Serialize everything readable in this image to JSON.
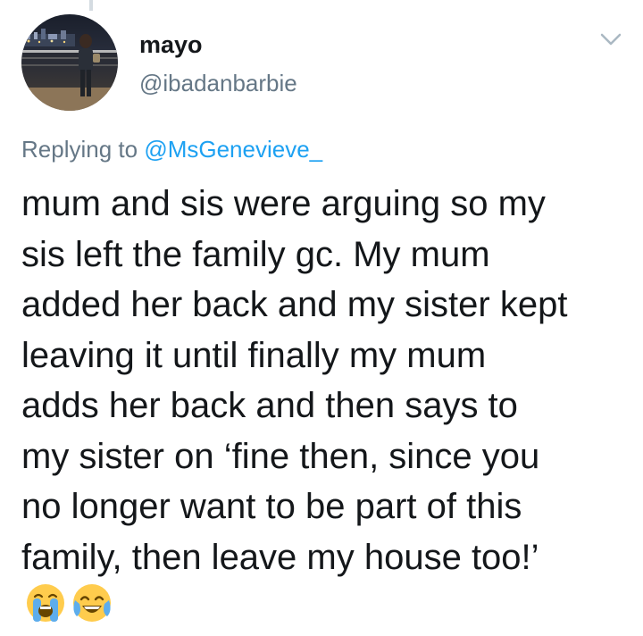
{
  "tweet": {
    "author": {
      "display_name": "mayo",
      "handle": "@ibadanbarbie",
      "avatar_icon": "profile-photo-night-waterfront"
    },
    "reply_to": {
      "prefix": "Replying to ",
      "mention": "@MsGenevieve_"
    },
    "text_lines": [
      "mum and sis were arguing so my",
      "sis left the family gc. My mum",
      "added her back and my sister kept",
      "leaving it until finally my mum",
      "adds her back and then says to",
      "my sister on ‘fine then, since you",
      "no longer want to be part of this",
      "family, then leave my house too!’"
    ],
    "emojis": [
      "loudly-crying-face-emoji",
      "face-with-tears-of-joy-emoji"
    ],
    "menu_icon": "chevron-down-icon"
  },
  "colors": {
    "text_primary": "#14171a",
    "text_secondary": "#657786",
    "link": "#1da1f2",
    "thread_line": "#d4dbe1"
  }
}
